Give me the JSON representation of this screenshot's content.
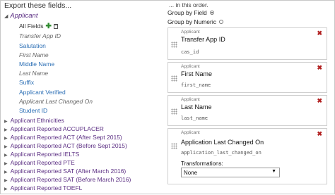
{
  "left": {
    "title": "Export these fields...",
    "root": "Applicant",
    "fields": [
      {
        "label": "All Fields",
        "style": "plain"
      },
      {
        "label": "Transfer App ID",
        "style": "italic"
      },
      {
        "label": "Salutation",
        "style": "link"
      },
      {
        "label": "First Name",
        "style": "italic"
      },
      {
        "label": "Middle Name",
        "style": "link"
      },
      {
        "label": "Last Name",
        "style": "italic"
      },
      {
        "label": "Suffix",
        "style": "link"
      },
      {
        "label": "Applicant Verified",
        "style": "link"
      },
      {
        "label": "Applicant Last Changed On",
        "style": "italic"
      },
      {
        "label": "Student ID",
        "style": "link"
      }
    ],
    "groups": [
      "Applicant Ethnicities",
      "Applicant Reported ACCUPLACER",
      "Applicant Reported ACT (After Sept 2015)",
      "Applicant Reported ACT (Before Sept 2015)",
      "Applicant Reported IELTS",
      "Applicant Reported PTE",
      "Applicant Reported SAT (After March 2016)",
      "Applicant Reported SAT (Before March 2016)",
      "Applicant Reported TOEFL"
    ],
    "icons": {
      "add": "plus-icon",
      "delete": "trash-icon"
    }
  },
  "right": {
    "title": "... in this order.",
    "group_by_field": "Group by Field",
    "group_by_numeric": "Group by Numeric",
    "cards": [
      {
        "category": "Applicant",
        "name": "Transfer App ID",
        "key": "cas_id"
      },
      {
        "category": "Applicant",
        "name": "First Name",
        "key": "first_name"
      },
      {
        "category": "Applicant",
        "name": "Last Name",
        "key": "last_name"
      },
      {
        "category": "Applicant",
        "name": "Application Last Changed On",
        "key": "application_last_changed_on",
        "transformations_label": "Transformations:",
        "transformations_value": "None"
      }
    ],
    "close_symbol": "✖",
    "accent_close": "#b22222"
  }
}
